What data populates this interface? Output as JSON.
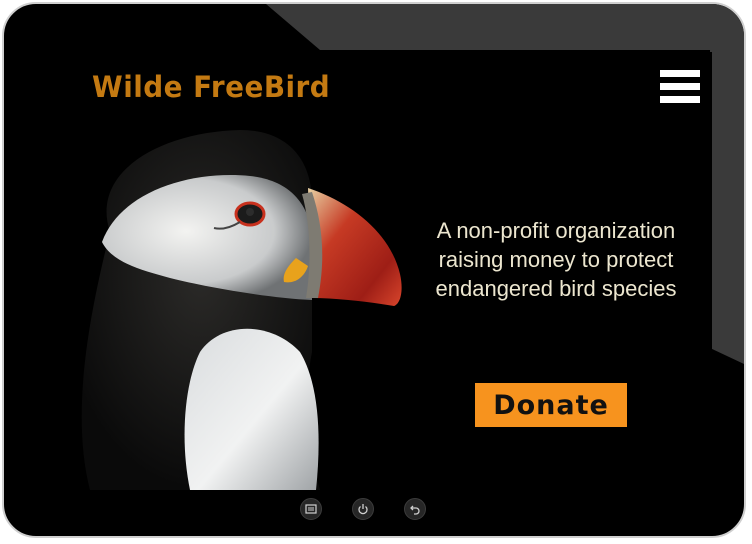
{
  "app": {
    "brand_name": "Wilde FreeBird"
  },
  "hero": {
    "tagline_lines": [
      "A non-profit organization",
      "raising money to protect",
      "endangered bird species"
    ],
    "image_subject": "puffin"
  },
  "actions": {
    "donate_label": "Donate"
  },
  "device": {
    "softkeys": [
      "recent-apps-icon",
      "power-icon",
      "back-icon"
    ]
  },
  "colors": {
    "background": "#000000",
    "brand": "#c47a12",
    "accent": "#f7931e",
    "tagline": "#ece6cf",
    "menu_icon": "#ffffff"
  }
}
